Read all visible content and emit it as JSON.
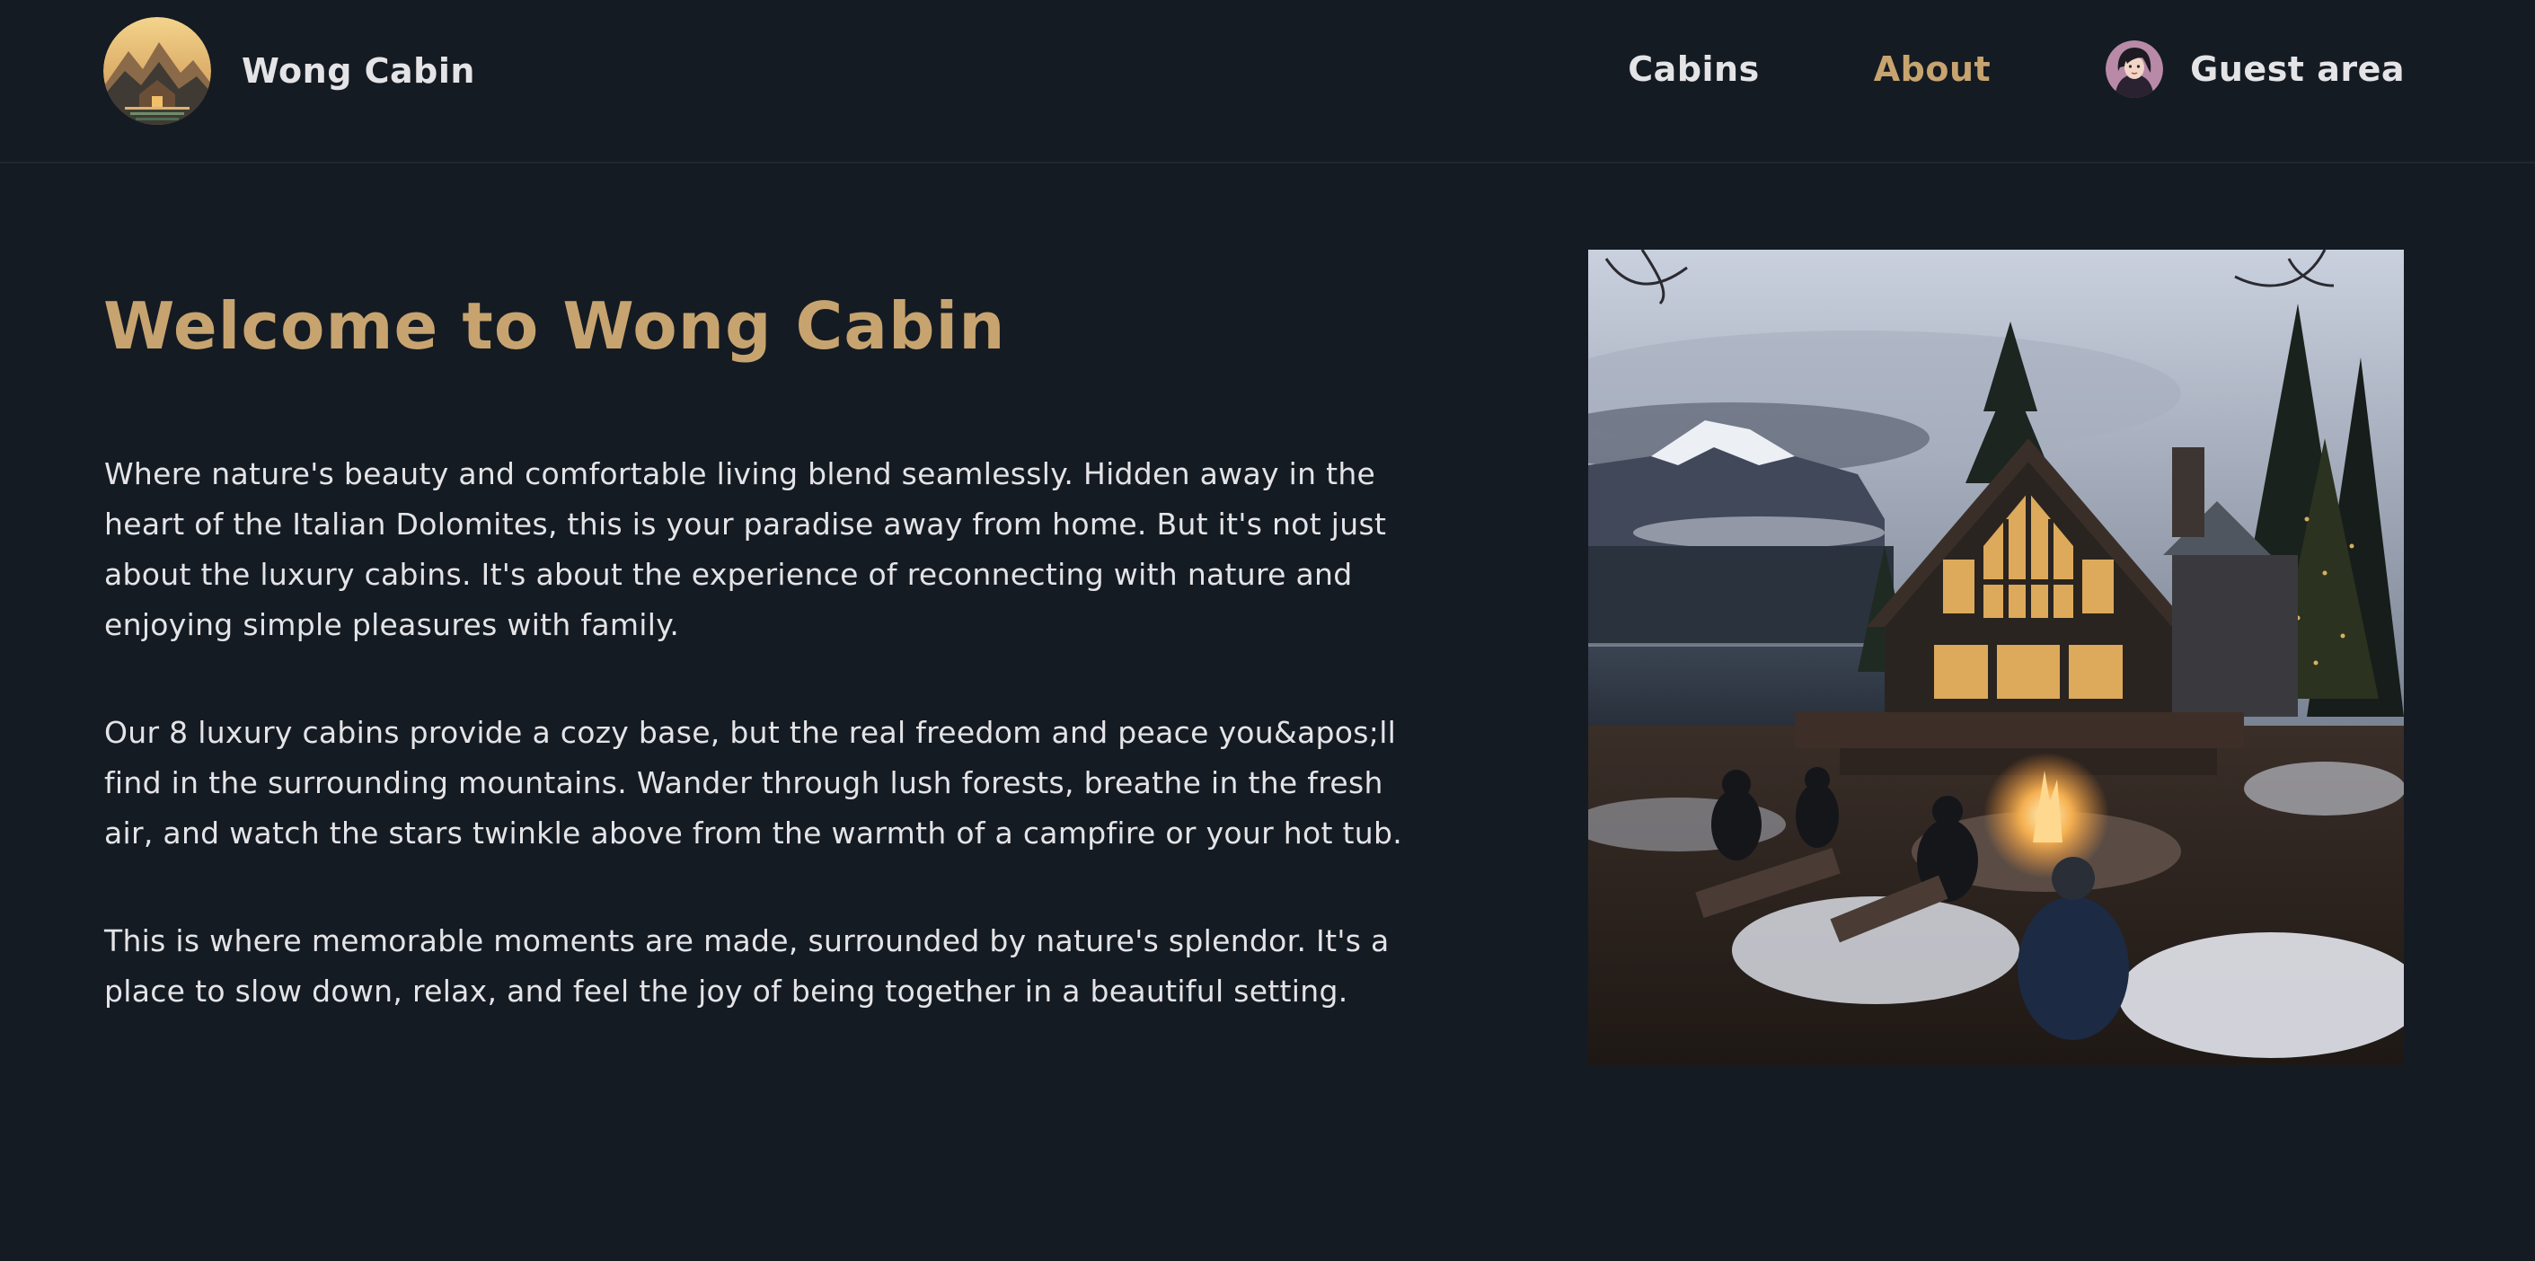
{
  "header": {
    "logo": {
      "text": "Wong Cabin",
      "icon": "cabin-logo-image"
    },
    "nav": [
      {
        "label": "Cabins",
        "active": false
      },
      {
        "label": "About",
        "active": true
      },
      {
        "label": "Guest area",
        "avatar": "user-avatar-image"
      }
    ]
  },
  "main": {
    "title": "Welcome to Wong Cabin",
    "paragraphs": [
      "Where nature's beauty and comfortable living blend seamlessly. Hidden away in the heart of the Italian Dolomites, this is your paradise away from home. But it's not just about the luxury cabins. It's about the experience of reconnecting with nature and enjoying simple pleasures with family.",
      "Our 8 luxury cabins provide a cozy base, but the real freedom and peace you&apos;ll find in the surrounding mountains. Wander through lush forests, breathe in the fresh air, and watch the stars twinkle above from the warmth of a campfire or your hot tub.",
      "This is where memorable moments are made, surrounded by nature's splendor. It's a place to slow down, relax, and feel the joy of being together in a beautiful setting."
    ],
    "image": {
      "description": "cabin-by-lake-campfire-photo"
    }
  },
  "colors": {
    "background": "#151b23",
    "accent": "#c7a46f",
    "text": "#e4e4e7"
  }
}
